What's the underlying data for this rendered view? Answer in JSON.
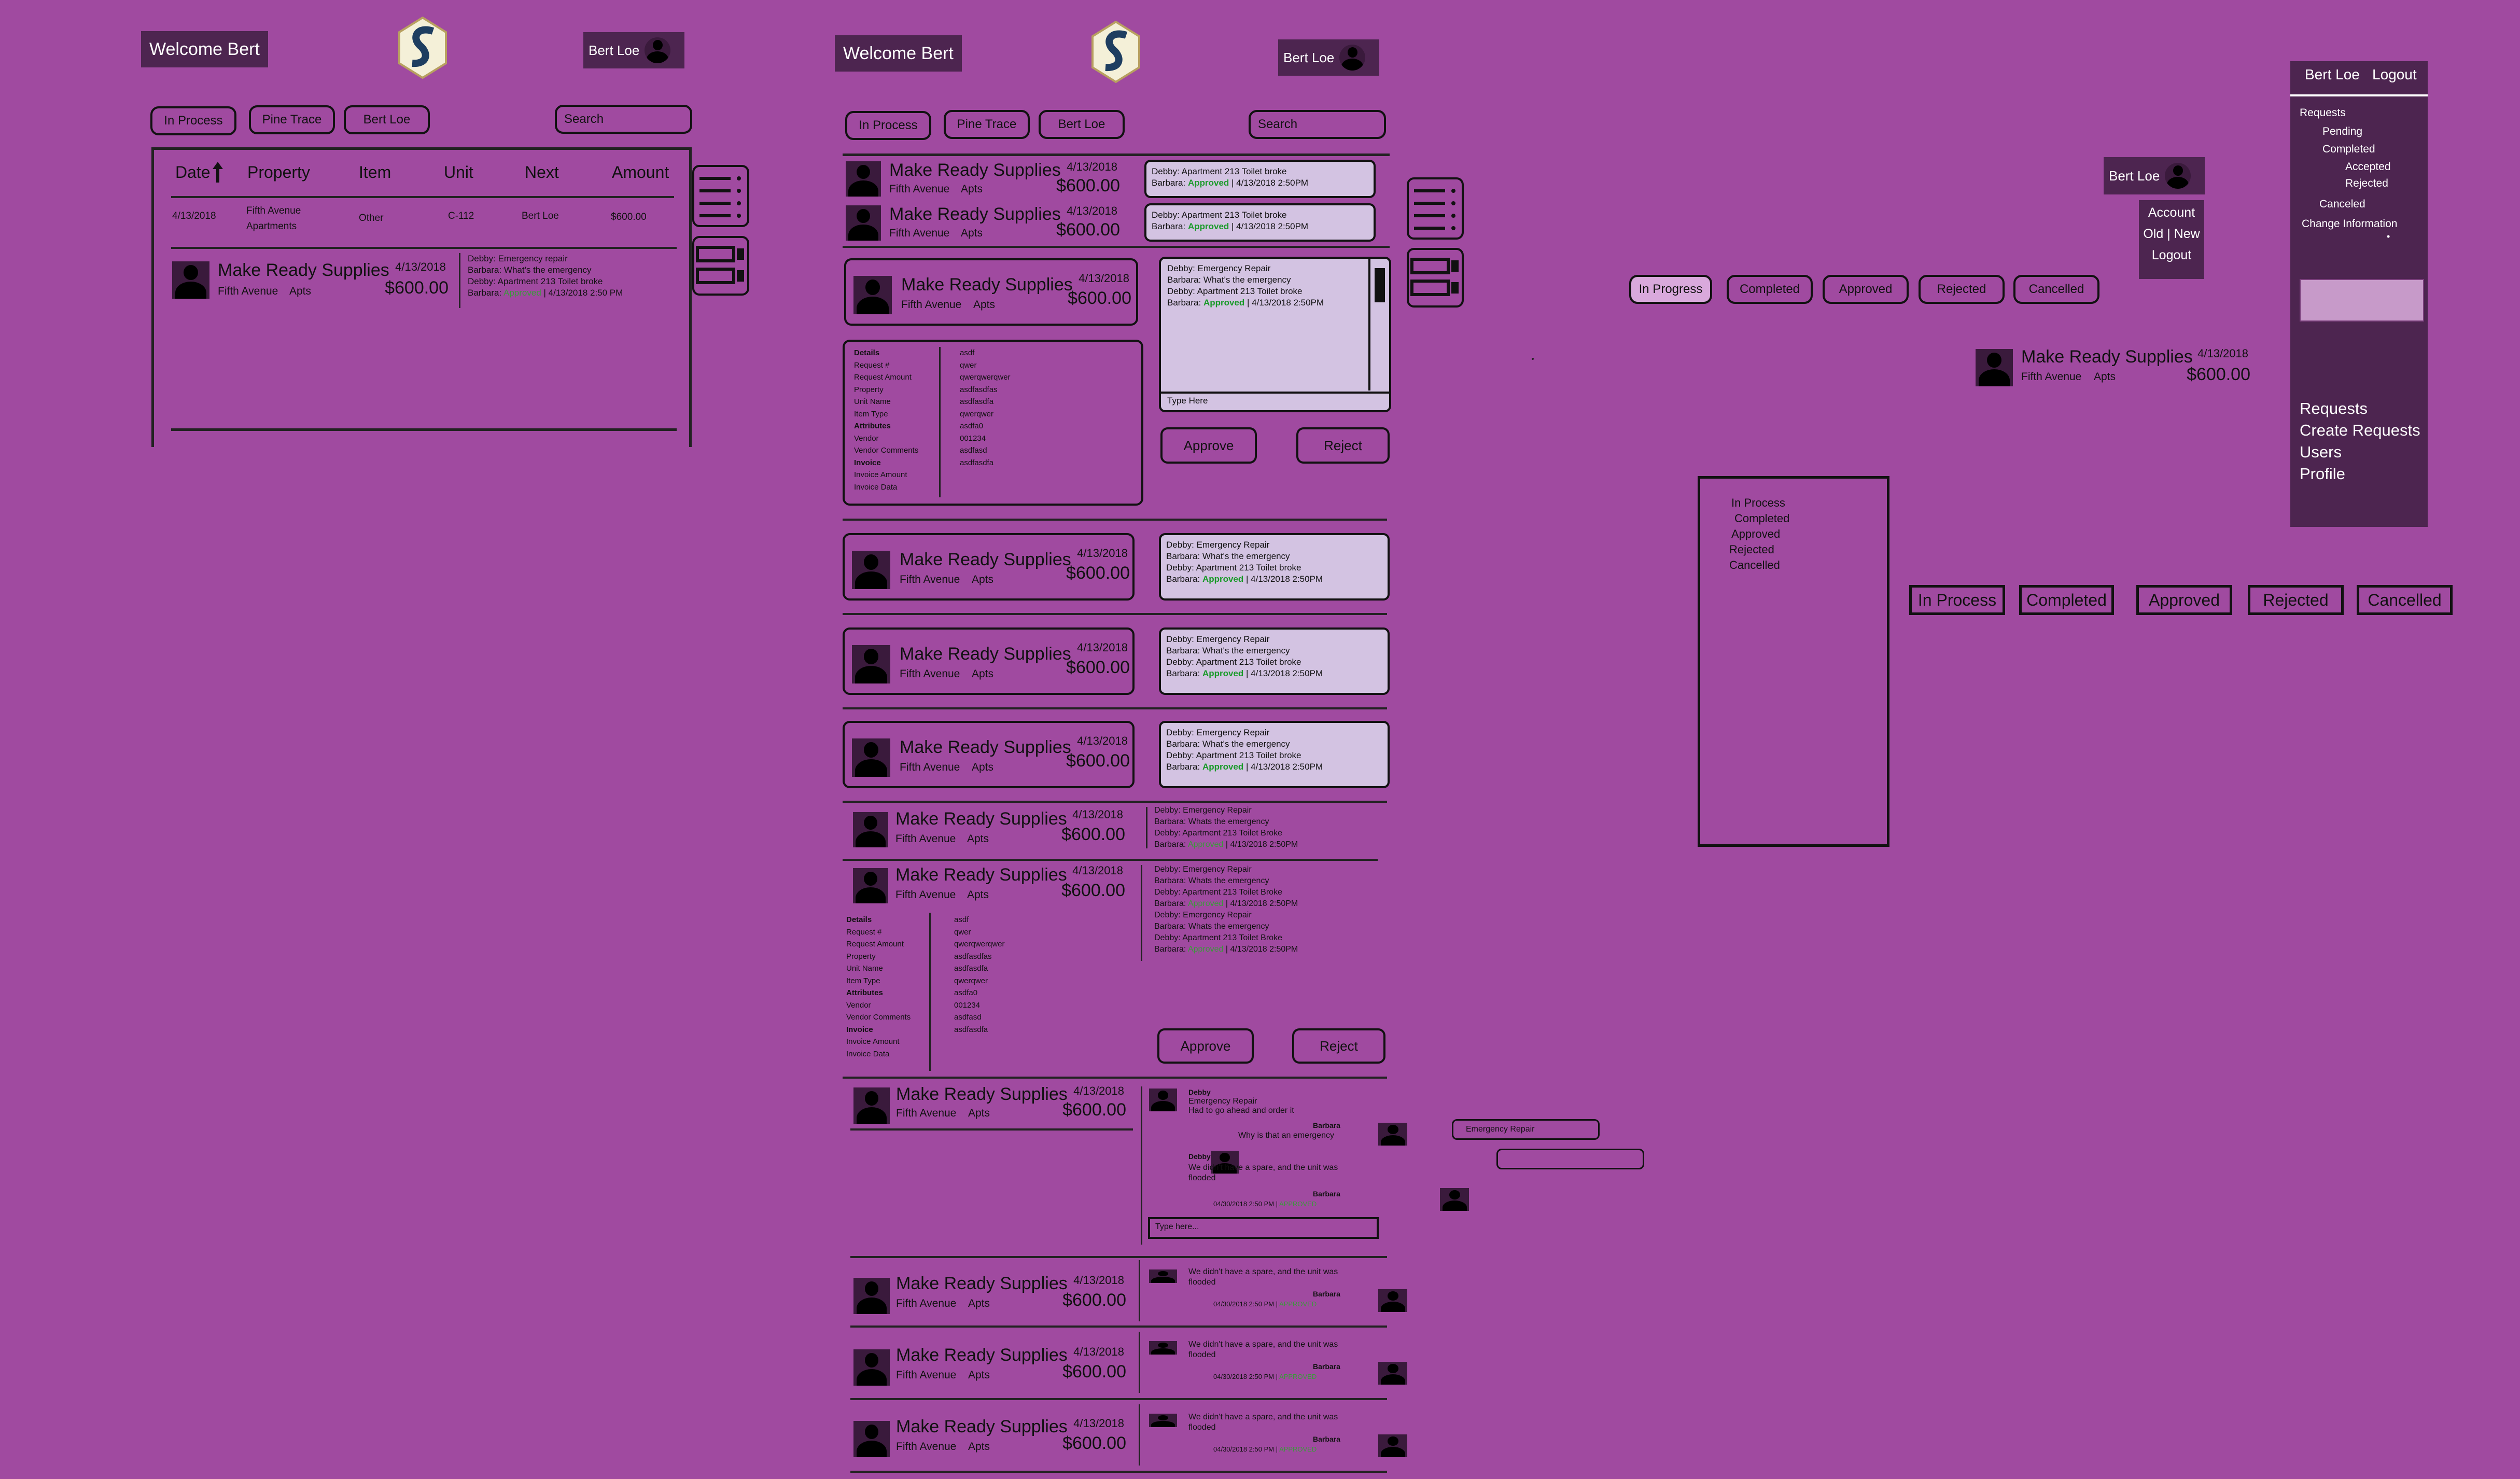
{
  "colors": {
    "background": "#a04aa0",
    "dark_panel": "#4d2550",
    "approved": "#1a9a2a",
    "bubble": "#d3c3e2",
    "selected_tab": "#d9a9dc"
  },
  "icons": {
    "avatar": "user-silhouette-icon",
    "logo": "shield-s-logo",
    "list": "list-view-icon",
    "cards": "card-view-icon",
    "sort": "arrow-up-icon"
  },
  "common": {
    "welcome": "Welcome Bert",
    "user_name": "Bert Loe",
    "search_placeholder": "Search",
    "request_title": "Make Ready Supplies",
    "property": "Fifth Avenue",
    "property_type": "Apts",
    "date": "4/13/2018",
    "amount": "$600.00",
    "approve": "Approve",
    "reject": "Reject",
    "type_here": "Type Here",
    "type_here2": "Type here..."
  },
  "filters": {
    "in_process": "In Process",
    "pine_trace": "Pine Trace",
    "user": "Bert Loe"
  },
  "table": {
    "headers": [
      "Date",
      "Property",
      "Item",
      "Unit",
      "Next",
      "Amount"
    ],
    "row": {
      "date": "4/13/2018",
      "property_line1": "Fifth Avenue",
      "property_line2": "Apartments",
      "item": "Other",
      "unit": "C-112",
      "next": "Bert Loe",
      "amount": "$600.00"
    }
  },
  "msgs_a": {
    "l1": "Debby: Emergency repair",
    "l2": "Barbara: What's the emergency",
    "l3": "Debby: Apartment 213 Toilet broke",
    "l4_name": "Barbara: ",
    "l4_status": "Approved",
    "l4_date": " | 4/13/2018 2:50 PM"
  },
  "msgs_b": {
    "l1": "Debby: Apartment 213 Toilet broke",
    "l2_name": "Barbara: ",
    "l2_status": "Approved",
    "l2_date": " | 4/13/2018 2:50PM"
  },
  "msgs_c": {
    "l1": "Debby: Emergency Repair",
    "l2": "Barbara: What's the emergency",
    "l3": "Debby: Apartment 213 Toilet broke",
    "l4_name": "Barbara: ",
    "l4_status": "Approved",
    "l4_date": " | 4/13/2018 2:50PM"
  },
  "msgs_d": {
    "l1": "Debby: Emergency Repair",
    "l2": "Barbara: Whats the emergency",
    "l3": "Debby: Apartment 213 Toilet Broke",
    "l4_name": "Barbara: ",
    "l4_status": "Approved",
    "l4_date": " | 4/13/2018  2:50PM"
  },
  "details": {
    "labels": [
      "Details",
      "Request #",
      "Request Amount",
      "Property",
      "Unit Name",
      "Item Type",
      "Attributes",
      "Vendor",
      "Vendor Comments",
      "Invoice",
      "Invoice Amount",
      "Invoice Data"
    ],
    "values": [
      "asdf",
      "qwer",
      "qwerqwerqwer",
      "asdfasdfas",
      "",
      "asdfasdfa",
      "qwerqwer",
      "",
      "asdfa0",
      "001234",
      "asdfasd",
      "asdfasdfa"
    ]
  },
  "chat": {
    "debby": "Debby",
    "barbara": "Barbara",
    "m1": "Emergency Repair",
    "m2": "Had to go ahead and order it",
    "m3": "Why is that an emergency",
    "m4a": "We didn't have a spare, and the unit was",
    "m4b": "flooded",
    "stamp": "04/30/2018 2:50 PM",
    "stamp_status": "APPROVED",
    "bubble1": "Emergency Repair"
  },
  "account_menu": {
    "account": "Account",
    "old": "Old",
    "sep": "|",
    "new": "New",
    "logout": "Logout"
  },
  "status_tabs": [
    "In Progress",
    "Completed",
    "Approved",
    "Rejected",
    "Cancelled"
  ],
  "status_list": [
    "In Process",
    "Completed",
    "Approved",
    "Rejected",
    "Cancelled"
  ],
  "status_buttons": [
    "In Process",
    "Completed",
    "Approved",
    "Rejected",
    "Cancelled"
  ],
  "sidebar": {
    "user": "Bert Loe",
    "logout": "Logout",
    "tree": {
      "requests": "Requests",
      "pending": "Pending",
      "completed": "Completed",
      "accepted": "Accepted",
      "rejected": "Rejected",
      "canceled": "Canceled",
      "change": "Change Information",
      "dot": "•"
    },
    "nav": [
      "Requests",
      "Create Requests",
      "Users",
      "Profile"
    ]
  }
}
